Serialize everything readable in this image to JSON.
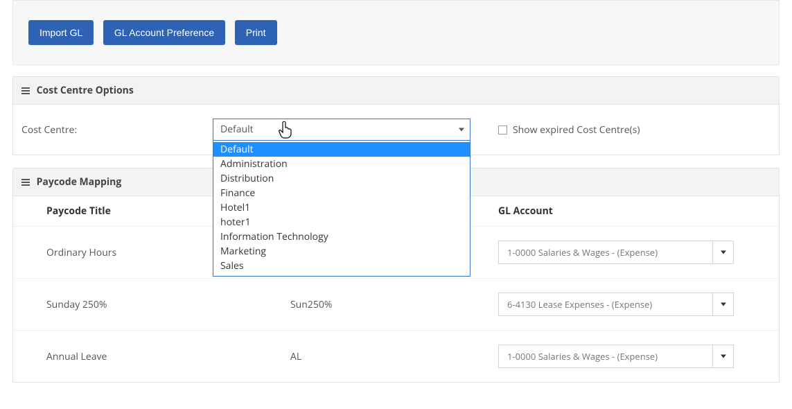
{
  "toolbar": {
    "import_gl": "Import GL",
    "gl_pref": "GL Account Preference",
    "print": "Print"
  },
  "cost_centre_panel": {
    "title": "Cost Centre Options",
    "label": "Cost Centre:",
    "selected": "Default",
    "options": [
      "Default",
      "Administration",
      "Distribution",
      "Finance",
      "Hotel1",
      "hoter1",
      "Information Technology",
      "Marketing",
      "Sales"
    ],
    "show_expired_label": "Show expired Cost Centre(s)",
    "show_expired_checked": false
  },
  "paycode_panel": {
    "title": "Paycode Mapping",
    "columns": {
      "title": "Paycode Title",
      "export": "",
      "gl": "GL Account"
    },
    "rows": [
      {
        "title": "Ordinary Hours",
        "export": "",
        "gl": "1-0000 Salaries & Wages - (Expense)"
      },
      {
        "title": "Sunday 250%",
        "export": "Sun250%",
        "gl": "6-4130 Lease Expenses - (Expense)"
      },
      {
        "title": "Annual Leave",
        "export": "AL",
        "gl": "1-0000 Salaries & Wages - (Expense)"
      }
    ]
  }
}
